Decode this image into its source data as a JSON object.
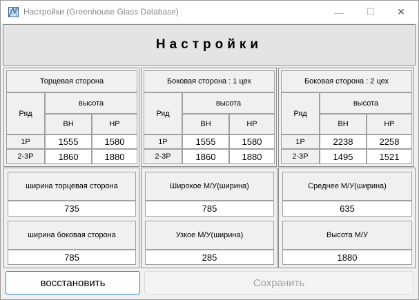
{
  "window": {
    "title": "Настройки (Greenhouse Glass Database)",
    "controls": {
      "minimize": "—",
      "maximize": "☐",
      "close": "✕"
    }
  },
  "header": {
    "title": "Настройки"
  },
  "tables": [
    {
      "title": "Торцевая сторона",
      "row_header": "Ряд",
      "height_header": "высота",
      "col_bh": "ВН",
      "col_hp": "НР",
      "rows": [
        {
          "label": "1Р",
          "bh": "1555",
          "hp": "1580"
        },
        {
          "label": "2-3Р",
          "bh": "1860",
          "hp": "1880"
        }
      ]
    },
    {
      "title": "Боковая сторона : 1 цех",
      "row_header": "Ряд",
      "height_header": "высота",
      "col_bh": "ВН",
      "col_hp": "НР",
      "rows": [
        {
          "label": "1Р",
          "bh": "1555",
          "hp": "1580"
        },
        {
          "label": "2-3Р",
          "bh": "1860",
          "hp": "1880"
        }
      ]
    },
    {
      "title": "Боковая сторона : 2 цех",
      "row_header": "Ряд",
      "height_header": "высота",
      "col_bh": "ВН",
      "col_hp": "НР",
      "rows": [
        {
          "label": "1Р",
          "bh": "2238",
          "hp": "2258"
        },
        {
          "label": "2-3Р",
          "bh": "1495",
          "hp": "1521"
        }
      ]
    }
  ],
  "fields": [
    {
      "top": {
        "label": "ширина торцевая сторона",
        "value": "735"
      },
      "bottom": {
        "label": "ширина боковая сторона",
        "value": "785"
      }
    },
    {
      "top": {
        "label": "Широкое М/У(ширина)",
        "value": "785"
      },
      "bottom": {
        "label": "Узкое М/У(ширина)",
        "value": "285"
      }
    },
    {
      "top": {
        "label": "Среднее М/У(ширина)",
        "value": "635"
      },
      "bottom": {
        "label": "Высота М/У",
        "value": "1880"
      }
    }
  ],
  "buttons": {
    "restore": "восстановить",
    "save": "Сохранить"
  },
  "colors": {
    "accent": "#2a7fd1",
    "panel": "#f0f0f0",
    "header": "#e4e4e4"
  },
  "icons": {
    "app": "greenhouse-glass-icon"
  }
}
